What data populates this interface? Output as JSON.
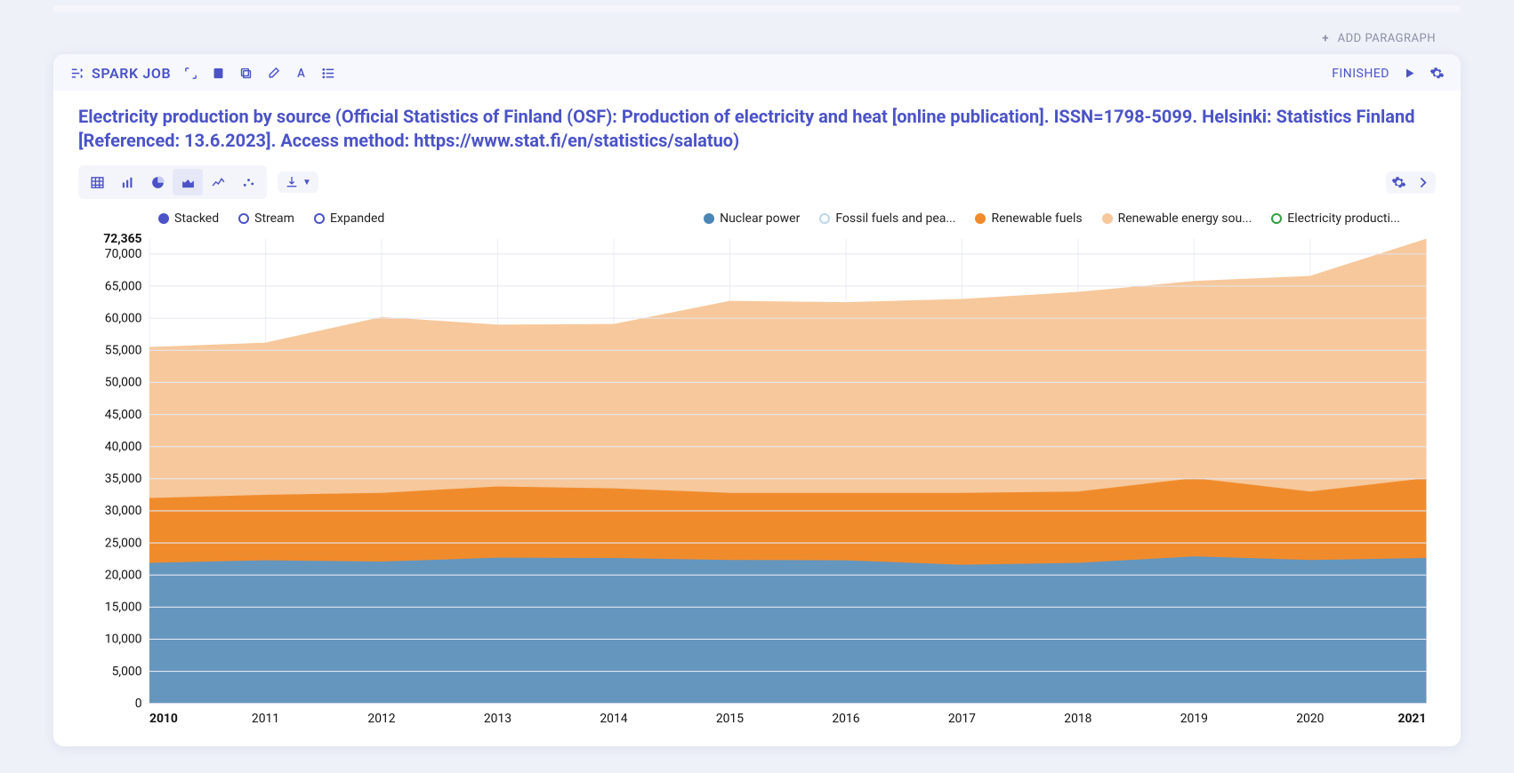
{
  "add_paragraph_label": "ADD PARAGRAPH",
  "header": {
    "spark_label": "SPARK JOB",
    "status": "FINISHED"
  },
  "title": "Electricity production by source (Official Statistics of Finland (OSF): Production of electricity and heat [online publication]. ISSN=1798-5099. Helsinki: Statistics Finland [Referenced: 13.6.2023]. Access method: https://www.stat.fi/en/statistics/salatuo)",
  "mode_legend": {
    "items": [
      {
        "label": "Stacked",
        "fill": "#4b53c6",
        "hollow": false
      },
      {
        "label": "Stream",
        "fill": "#4b53c6",
        "hollow": true
      },
      {
        "label": "Expanded",
        "fill": "#4b53c6",
        "hollow": true
      }
    ]
  },
  "series_legend": {
    "items": [
      {
        "label": "Nuclear power",
        "fill": "#4b86b4",
        "hollow": false
      },
      {
        "label": "Fossil fuels and pea...",
        "fill": "#bcd7ea",
        "hollow": true
      },
      {
        "label": "Renewable fuels",
        "fill": "#f08b2c",
        "hollow": false
      },
      {
        "label": "Renewable energy sou...",
        "fill": "#f6c89b",
        "hollow": false
      },
      {
        "label": "Electricity producti...",
        "fill": "#2e9e3f",
        "hollow": true
      }
    ]
  },
  "chart_data": {
    "type": "area",
    "stacked": true,
    "x": [
      2010,
      2011,
      2012,
      2013,
      2014,
      2015,
      2016,
      2017,
      2018,
      2019,
      2020,
      2021
    ],
    "series": [
      {
        "name": "Nuclear power",
        "color": "#6596be",
        "values": [
          21900,
          22300,
          22100,
          22700,
          22650,
          22350,
          22300,
          21600,
          21900,
          22900,
          22350,
          22650
        ]
      },
      {
        "name": "Renewable fuels",
        "color": "#f08b2c",
        "values": [
          10100,
          10200,
          10700,
          11100,
          10850,
          10450,
          10500,
          11200,
          11100,
          12200,
          10650,
          12450
        ]
      },
      {
        "name": "Renewable energy sources",
        "color": "#f6c89b",
        "values": [
          23500,
          23700,
          27400,
          25200,
          25600,
          29900,
          29700,
          30200,
          31100,
          30700,
          33600,
          37265
        ]
      }
    ],
    "xlabel": "",
    "ylabel": "",
    "ylim": [
      0,
      72365
    ],
    "yticks": [
      0,
      5000,
      10000,
      15000,
      20000,
      25000,
      30000,
      35000,
      40000,
      45000,
      50000,
      55000,
      60000,
      65000,
      70000
    ],
    "ymax_label": "72,365"
  }
}
